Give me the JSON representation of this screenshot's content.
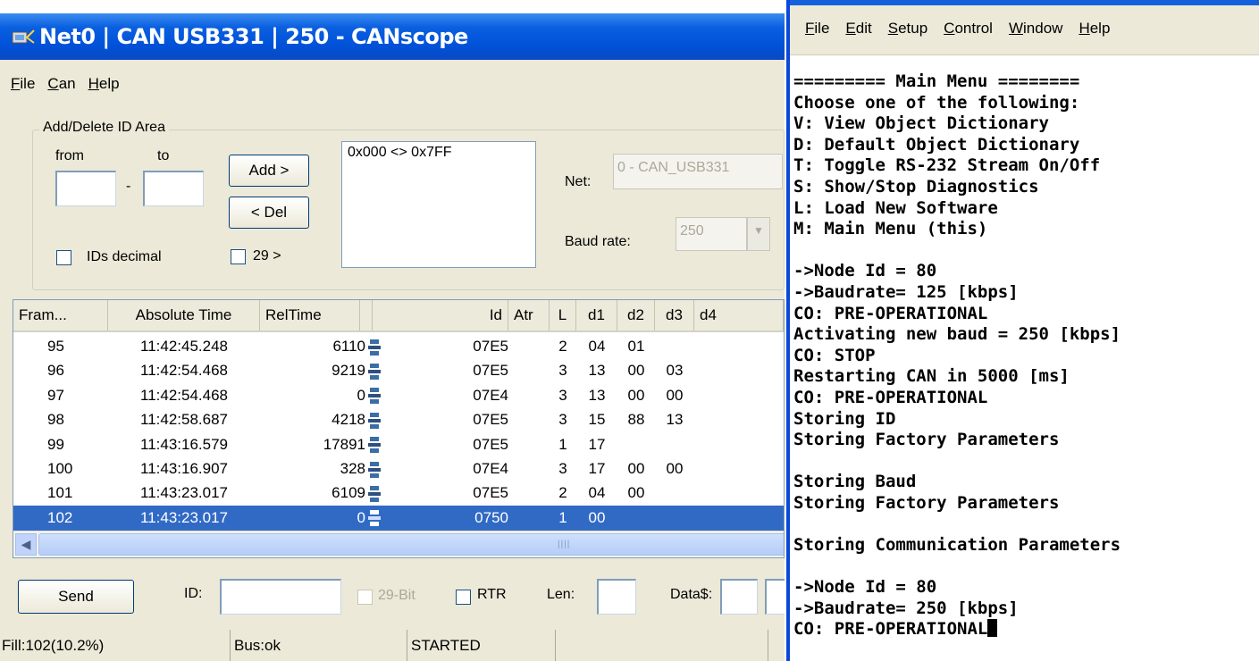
{
  "left_window": {
    "title": "Net0 | CAN USB331 | 250 - CANscope",
    "menu": [
      "File",
      "Can",
      "Help"
    ],
    "id_area": {
      "legend": "Add/Delete ID Area",
      "from_label": "from",
      "to_label": "to",
      "dash": "-",
      "from_value": "",
      "to_value": "",
      "add_button": "Add >",
      "del_button": "< Del",
      "bit29_button": "29 >",
      "ids_decimal_label": "IDs decimal",
      "id_list": [
        "0x000 <> 0x7FF"
      ]
    },
    "net_label": "Net:",
    "net_value": "0 - CAN_USB331",
    "baud_label": "Baud rate:",
    "baud_value": "250",
    "table": {
      "columns": [
        "Fram...",
        "Absolute Time",
        "RelTime",
        "",
        "Id",
        "Atr",
        "L",
        "d1",
        "d2",
        "d3",
        "d4"
      ],
      "rows": [
        {
          "frame": "95",
          "abs": "11:42:45.248",
          "rel": "6110",
          "id": "07E5",
          "atr": "",
          "l": "2",
          "d1": "04",
          "d2": "01",
          "d3": "",
          "selected": false
        },
        {
          "frame": "96",
          "abs": "11:42:54.468",
          "rel": "9219",
          "id": "07E5",
          "atr": "",
          "l": "3",
          "d1": "13",
          "d2": "00",
          "d3": "03",
          "selected": false
        },
        {
          "frame": "97",
          "abs": "11:42:54.468",
          "rel": "0",
          "id": "07E4",
          "atr": "",
          "l": "3",
          "d1": "13",
          "d2": "00",
          "d3": "00",
          "selected": false
        },
        {
          "frame": "98",
          "abs": "11:42:58.687",
          "rel": "4218",
          "id": "07E5",
          "atr": "",
          "l": "3",
          "d1": "15",
          "d2": "88",
          "d3": "13",
          "selected": false
        },
        {
          "frame": "99",
          "abs": "11:43:16.579",
          "rel": "17891",
          "id": "07E5",
          "atr": "",
          "l": "1",
          "d1": "17",
          "d2": "",
          "d3": "",
          "selected": false
        },
        {
          "frame": "100",
          "abs": "11:43:16.907",
          "rel": "328",
          "id": "07E4",
          "atr": "",
          "l": "3",
          "d1": "17",
          "d2": "00",
          "d3": "00",
          "selected": false
        },
        {
          "frame": "101",
          "abs": "11:43:23.017",
          "rel": "6109",
          "id": "07E5",
          "atr": "",
          "l": "2",
          "d1": "04",
          "d2": "00",
          "d3": "",
          "selected": false
        },
        {
          "frame": "102",
          "abs": "11:43:23.017",
          "rel": "0",
          "id": "0750",
          "atr": "",
          "l": "1",
          "d1": "00",
          "d2": "",
          "d3": "",
          "selected": true
        }
      ]
    },
    "send_bar": {
      "send_button": "Send",
      "id_label": "ID:",
      "id_value": "",
      "bit29_label": "29-Bit",
      "rtr_label": "RTR",
      "len_label": "Len:",
      "len_value": "",
      "data_label": "Data$:",
      "data_value": ""
    },
    "status": {
      "fill": "Fill:102(10.2%)",
      "bus": "Bus:ok",
      "state": "STARTED"
    }
  },
  "right_window": {
    "menu": [
      "File",
      "Edit",
      "Setup",
      "Control",
      "Window",
      "Help"
    ],
    "lines": [
      "========= Main Menu ========",
      "Choose one of the following:",
      "V: View Object Dictionary",
      "D: Default Object Dictionary",
      "T: Toggle RS-232 Stream On/Off",
      "S: Show/Stop Diagnostics",
      "L: Load New Software",
      "M: Main Menu (this)",
      "",
      "->Node Id = 80",
      "->Baudrate= 125 [kbps]",
      "CO: PRE-OPERATIONAL",
      "Activating new baud = 250 [kbps]",
      "CO: STOP",
      "Restarting CAN in 5000 [ms]",
      "CO: PRE-OPERATIONAL",
      "Storing ID",
      "Storing Factory Parameters",
      "",
      "Storing Baud",
      "Storing Factory Parameters",
      "",
      "Storing Communication Parameters",
      "",
      "->Node Id = 80",
      "->Baudrate= 250 [kbps]",
      "CO: PRE-OPERATIONAL"
    ]
  },
  "colors": {
    "titlebar": "#0054e3",
    "selection": "#316ac5",
    "window_bg": "#ece9d8"
  }
}
